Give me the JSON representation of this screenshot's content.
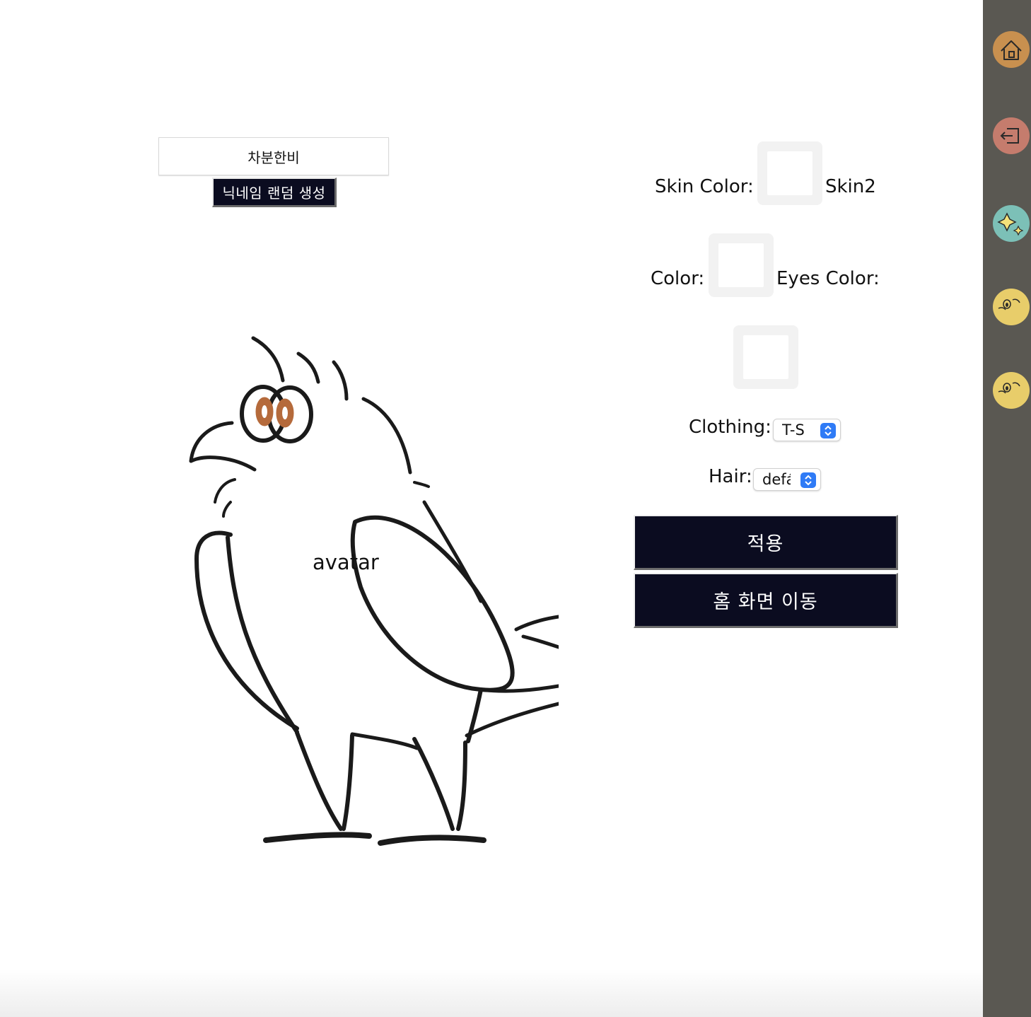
{
  "profile": {
    "nickname": "차분한비",
    "random_button": "닉네임 랜덤 생성",
    "avatar_alt": "avatar"
  },
  "form": {
    "skin_color_label": "Skin Color:",
    "skin2_label": "Skin2",
    "color_label": "Color:",
    "eyes_color_label": "Eyes Color:",
    "clothing_label": "Clothing:",
    "clothing_value": "T-S",
    "hair_label": "Hair:",
    "hair_value": "defá"
  },
  "actions": {
    "apply": "적용",
    "home": "홈 화면 이동"
  },
  "sidebar": {
    "icons": [
      "home-icon",
      "logout-icon",
      "sparkle-icon",
      "chick-icon",
      "chick-icon"
    ]
  },
  "colors": {
    "button_bg": "#0b0c20",
    "sidebar_bg": "#5a5852",
    "eye_color": "#b56a3b",
    "select_accent": "#2f7bf6"
  }
}
